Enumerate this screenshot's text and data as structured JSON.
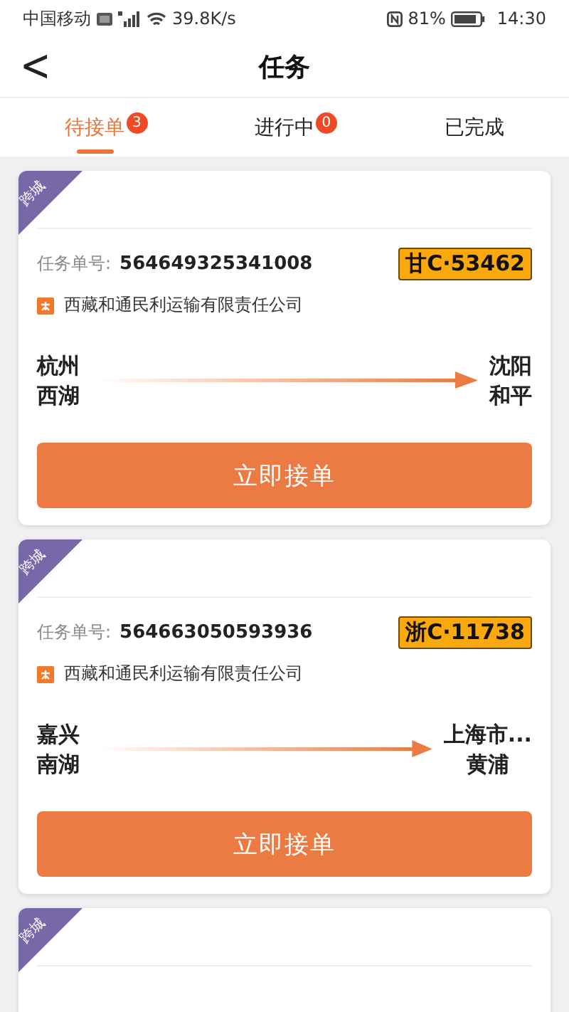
{
  "status_bar": {
    "carrier": "中国移动",
    "speed": "39.8K/s",
    "battery": "81%",
    "time": "14:30"
  },
  "header": {
    "back": "<",
    "title": "任务"
  },
  "tabs": [
    {
      "label": "待接单",
      "badge": "3",
      "selected": true
    },
    {
      "label": "进行中",
      "badge": "0",
      "selected": false
    },
    {
      "label": "已完成",
      "selected": false
    }
  ],
  "cards": [
    {
      "tag": "跨城",
      "number_label": "任务单号:",
      "number": "564649325341008",
      "plate": "甘C·53462",
      "company": "西藏和通民利运输有限责任公司",
      "origin": [
        "杭州",
        "西湖"
      ],
      "destination": [
        "沈阳",
        "和平"
      ],
      "button": "立即接单"
    },
    {
      "tag": "跨城",
      "number_label": "任务单号:",
      "number": "564663050593936",
      "plate": "浙C·11738",
      "company": "西藏和通民利运输有限责任公司",
      "origin": [
        "嘉兴",
        "南湖"
      ],
      "destination": [
        "上海市...",
        "黄浦"
      ],
      "button": "立即接单"
    },
    {
      "tag": "跨城"
    }
  ]
}
